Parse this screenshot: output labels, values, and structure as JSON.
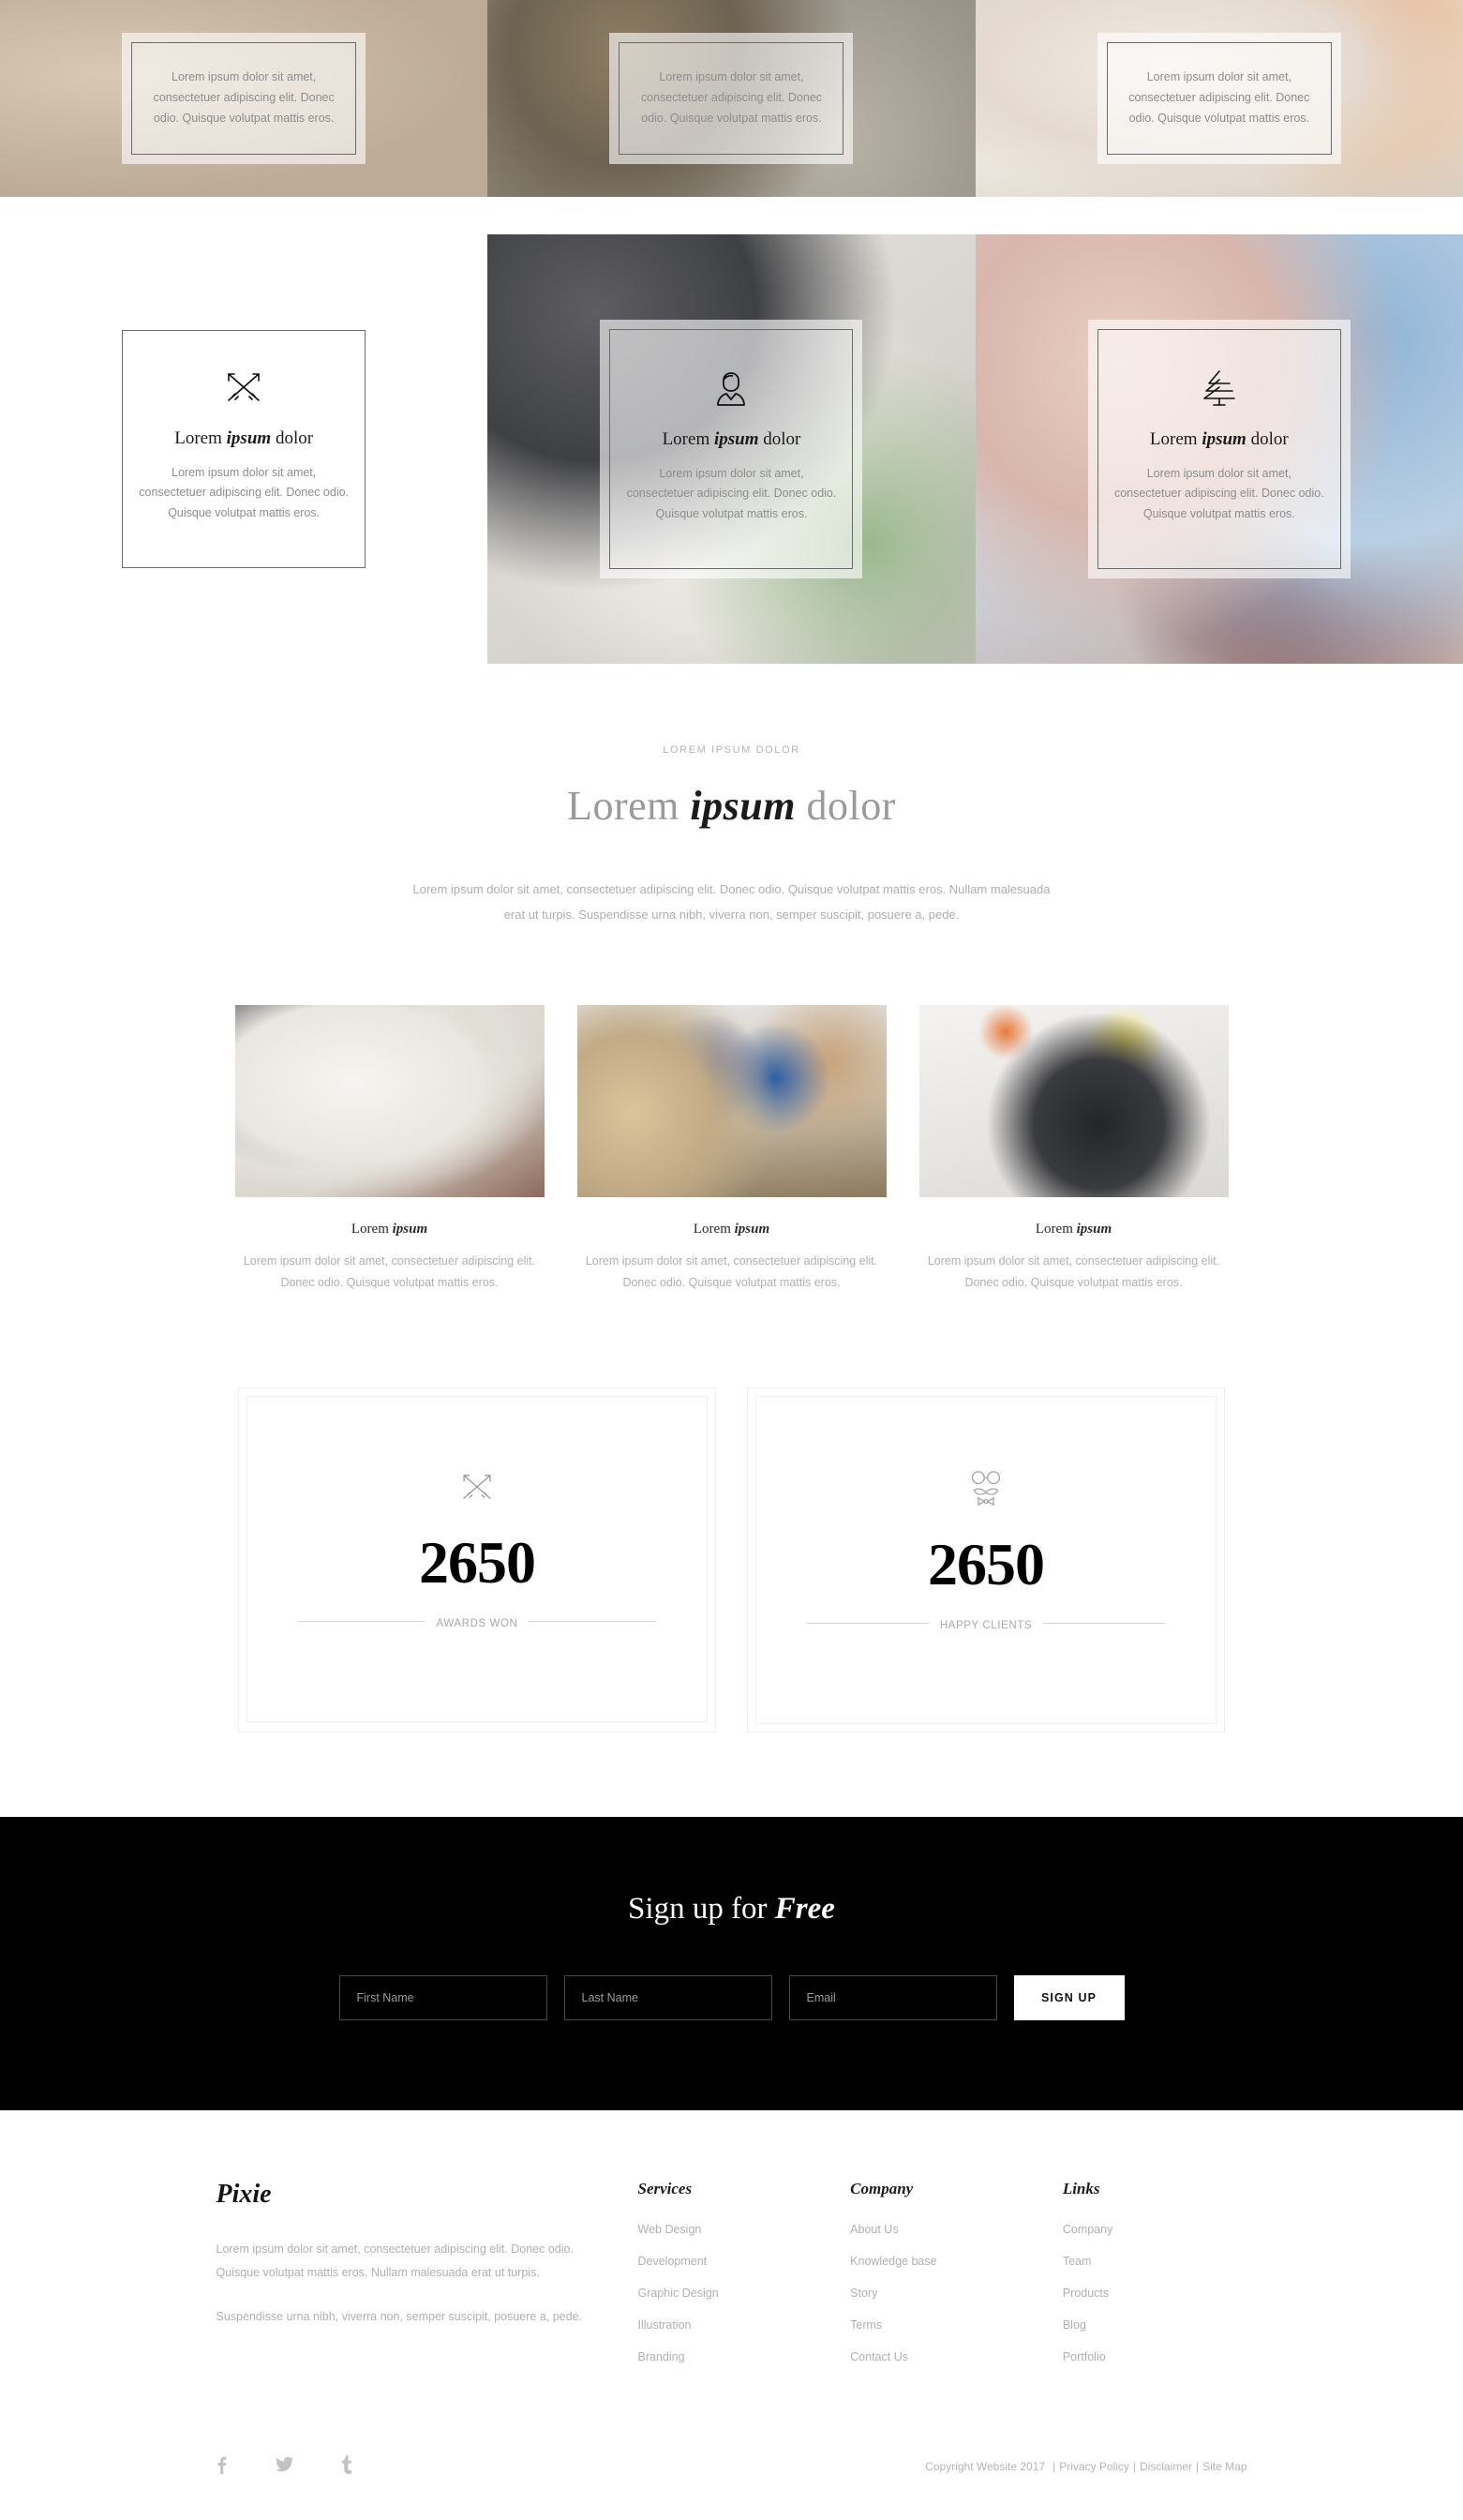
{
  "portfolio": {
    "row1": [
      {
        "text": "Lorem ipsum dolor sit amet, consectetuer adipiscing elit. Donec odio. Quisque volutpat mattis eros."
      },
      {
        "text": "Lorem ipsum dolor sit amet, consectetuer adipiscing elit. Donec odio. Quisque volutpat mattis eros."
      },
      {
        "text": "Lorem ipsum dolor sit amet, consectetuer adipiscing elit. Donec odio. Quisque volutpat mattis eros."
      }
    ],
    "row2": [
      {
        "icon": "crossed-arrows-icon",
        "title_regular": "Lorem ",
        "title_italic": "ipsum",
        "title_rest": " dolor",
        "text": "Lorem ipsum dolor sit amet, consectetuer adipiscing elit. Donec odio. Quisque volutpat mattis eros."
      },
      {
        "icon": "person-icon",
        "title_regular": "Lorem ",
        "title_italic": "ipsum",
        "title_rest": " dolor",
        "text": "Lorem ipsum dolor sit amet, consectetuer adipiscing elit. Donec odio. Quisque volutpat mattis eros."
      },
      {
        "icon": "pine-tree-icon",
        "title_regular": "Lorem ",
        "title_italic": "ipsum",
        "title_rest": " dolor",
        "text": "Lorem ipsum dolor sit amet, consectetuer adipiscing elit. Donec odio. Quisque volutpat mattis eros."
      }
    ]
  },
  "intro": {
    "eyebrow": "LOREM IPSUM DOLOR",
    "title_pre": "Lorem ",
    "title_em": "ipsum",
    "title_post": " dolor",
    "lead": "Lorem ipsum dolor sit amet, consectetuer adipiscing elit. Donec odio. Quisque volutpat mattis eros. Nullam malesuada erat ut turpis. Suspendisse urna nibh, viverra non, semper suscipit, posuere a, pede."
  },
  "features": [
    {
      "image": "laptop-desk-photo",
      "title_pre": "Lorem ",
      "title_em": "ipsum",
      "text": "Lorem ipsum dolor sit amet, consectetuer adipiscing elit. Donec odio. Quisque volutpat mattis eros."
    },
    {
      "image": "team-meeting-photo",
      "title_pre": "Lorem ",
      "title_em": "ipsum",
      "text": "Lorem ipsum dolor sit amet, consectetuer adipiscing elit. Donec odio. Quisque volutpat mattis eros."
    },
    {
      "image": "whiteboard-planning-photo",
      "title_pre": "Lorem ",
      "title_em": "ipsum",
      "text": "Lorem ipsum dolor sit amet, consectetuer adipiscing elit. Donec odio. Quisque volutpat mattis eros."
    }
  ],
  "counters": [
    {
      "icon": "crossed-arrows-icon",
      "number": "2650",
      "label": "AWARDS WON"
    },
    {
      "icon": "hipster-glasses-icon",
      "number": "2650",
      "label": "HAPPY CLIENTS"
    }
  ],
  "signup": {
    "title_pre": "Sign up for ",
    "title_em": "Free",
    "first_name_placeholder": "First Name",
    "first_name_value": "",
    "last_name_placeholder": "Last Name",
    "last_name_value": "",
    "email_placeholder": "Email",
    "email_value": "",
    "button_label": "SIGN UP"
  },
  "footer": {
    "brand": "Pixie",
    "brand_text_1": "Lorem ipsum dolor sit amet, consectetuer adipiscing elit. Donec odio. Quisque volutpat mattis eros. Nullam malesuada erat ut turpis.",
    "brand_text_2": "Suspendisse urna nibh, viverra non, semper suscipit, posuere a, pede.",
    "columns": [
      {
        "title": "Services",
        "links": [
          "Web Design",
          "Development",
          "Graphic Design",
          "Illustration",
          "Branding"
        ]
      },
      {
        "title": "Company",
        "links": [
          "About Us",
          "Knowledge base",
          "Story",
          "Terms",
          "Contact Us"
        ]
      },
      {
        "title": "Links",
        "links": [
          "Company",
          "Team",
          "Products",
          "Blog",
          "Portfolio"
        ]
      }
    ],
    "social": [
      {
        "name": "facebook-icon",
        "glyph": "f"
      },
      {
        "name": "twitter-icon",
        "glyph": "t"
      },
      {
        "name": "tumblr-icon",
        "glyph": "t"
      }
    ],
    "copyright": "Copyright Website 2017",
    "bottom_links": [
      "Privacy Policy",
      "Disclaimer",
      "Site Map"
    ],
    "separator": "|"
  },
  "colors": {
    "accent_dark": "#000000",
    "muted_text": "#b0b0b0",
    "border_light": "#eeeeee"
  }
}
